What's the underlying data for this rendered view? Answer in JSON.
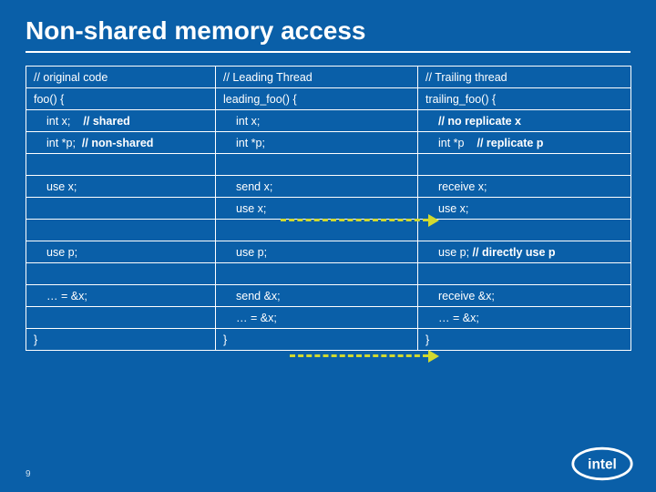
{
  "title": "Non-shared memory access",
  "page_number": "9",
  "columns": {
    "c1_header": "// original code",
    "c2_header": "// Leading Thread",
    "c3_header": "// Trailing thread"
  },
  "rows": {
    "fn_open": {
      "c1": "foo() {",
      "c2": "leading_foo() {",
      "c3": "trailing_foo() {"
    },
    "int_x": {
      "c1_a": "int x;",
      "c1_b": "// shared",
      "c2": "int x;",
      "c3": "// no replicate x"
    },
    "int_p": {
      "c1_a": "int *p;",
      "c1_b": "// non-shared",
      "c2": "int *p;",
      "c3_a": "int *p",
      "c3_b": "// replicate p"
    },
    "use_x": {
      "c1": "use x;",
      "c2": "send x;",
      "c3": "receive x;"
    },
    "use_x2": {
      "c1": "",
      "c2": "use x;",
      "c3": "use x;"
    },
    "use_p": {
      "c1": "use p;",
      "c2": "use p;",
      "c3_a": "use p;",
      "c3_b": "// directly use p"
    },
    "addr_x": {
      "c1": "… = &x;",
      "c2": "send &x;",
      "c3": "receive &x;"
    },
    "addr_x2": {
      "c1": "",
      "c2": "… = &x;",
      "c3": "… = &x;"
    },
    "fn_close": {
      "c1": "}",
      "c2": "}",
      "c3": "}"
    }
  },
  "logo_alt": "intel"
}
